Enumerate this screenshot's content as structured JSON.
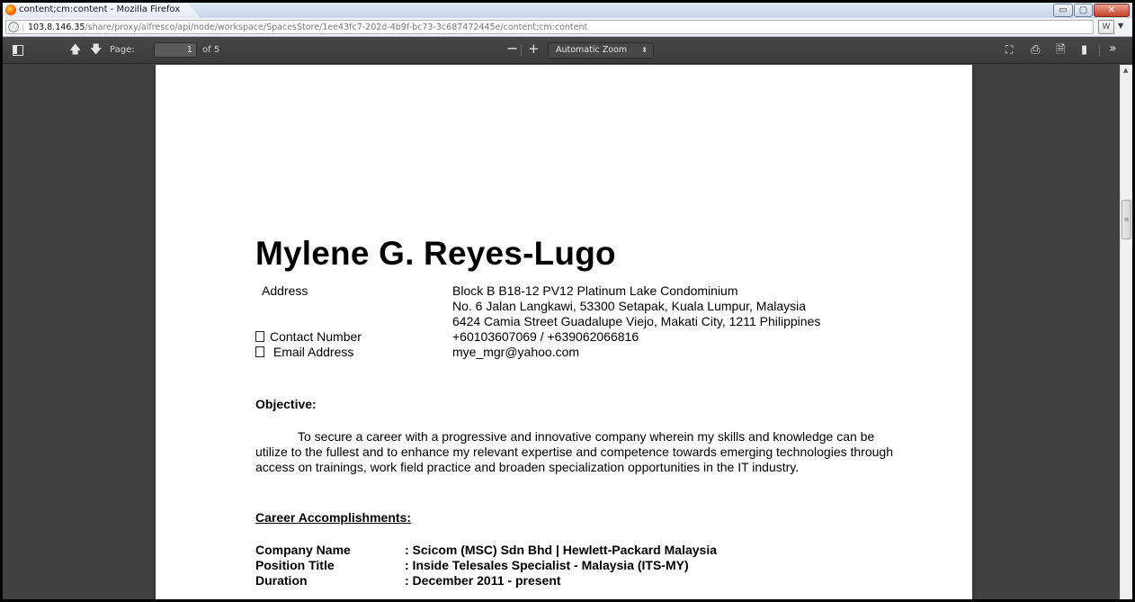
{
  "window": {
    "title": "content;cm:content - Mozilla Firefox",
    "controls": {
      "minimize": "▭",
      "maximize": "▢",
      "close": "✕"
    }
  },
  "urlbar": {
    "info_icon": "ⓘ",
    "host": "103.8.146.35",
    "path": "/share/proxy/alfresco/api/node/workspace/SpacesStore/1ee43fc7-202d-4b9f-bc73-3c687472445e/content;cm:content",
    "reader_icon": "W"
  },
  "toolbar": {
    "page_label": "Page:",
    "page_value": "1",
    "page_count": "of 5",
    "zoom": "Automatic Zoom",
    "icons": [
      "sidebar-toggle-icon",
      "arrow-up-icon",
      "arrow-down-icon",
      "zoom-out-icon",
      "zoom-in-icon",
      "presentation-icon",
      "print-icon",
      "download-icon",
      "bookmark-icon",
      "tools-icon"
    ]
  },
  "resume": {
    "name": "Mylene G. Reyes-Lugo",
    "address_label": "Address",
    "address_lines": [
      "Block B B18-12 PV12 Platinum Lake Condominium",
      "No. 6 Jalan Langkawi, 53300 Setapak, Kuala Lumpur, Malaysia",
      "6424 Camia Street Guadalupe Viejo, Makati City, 1211 Philippines"
    ],
    "contact_label": "Contact Number",
    "contact_value": "+60103607069 / +639062066816",
    "email_label": "Email Address",
    "email_value": "mye_mgr@yahoo.com",
    "objective_heading": "Objective:",
    "objective_text": "To secure a career with a progressive and innovative company wherein my skills and knowledge can be utilize to the fullest and to enhance my relevant expertise and competence towards emerging technologies through access on trainings, work field practice and broaden specialization opportunities in the IT industry.",
    "career_heading": "Career Accomplishments:",
    "career": [
      {
        "label": "Company Name",
        "value": ": Scicom (MSC) Sdn Bhd | Hewlett-Packard Malaysia"
      },
      {
        "label": "Position Title",
        "value": ": Inside Telesales Specialist - Malaysia (ITS-MY)"
      },
      {
        "label": "Duration",
        "value": ": December 2011 - present"
      }
    ]
  }
}
